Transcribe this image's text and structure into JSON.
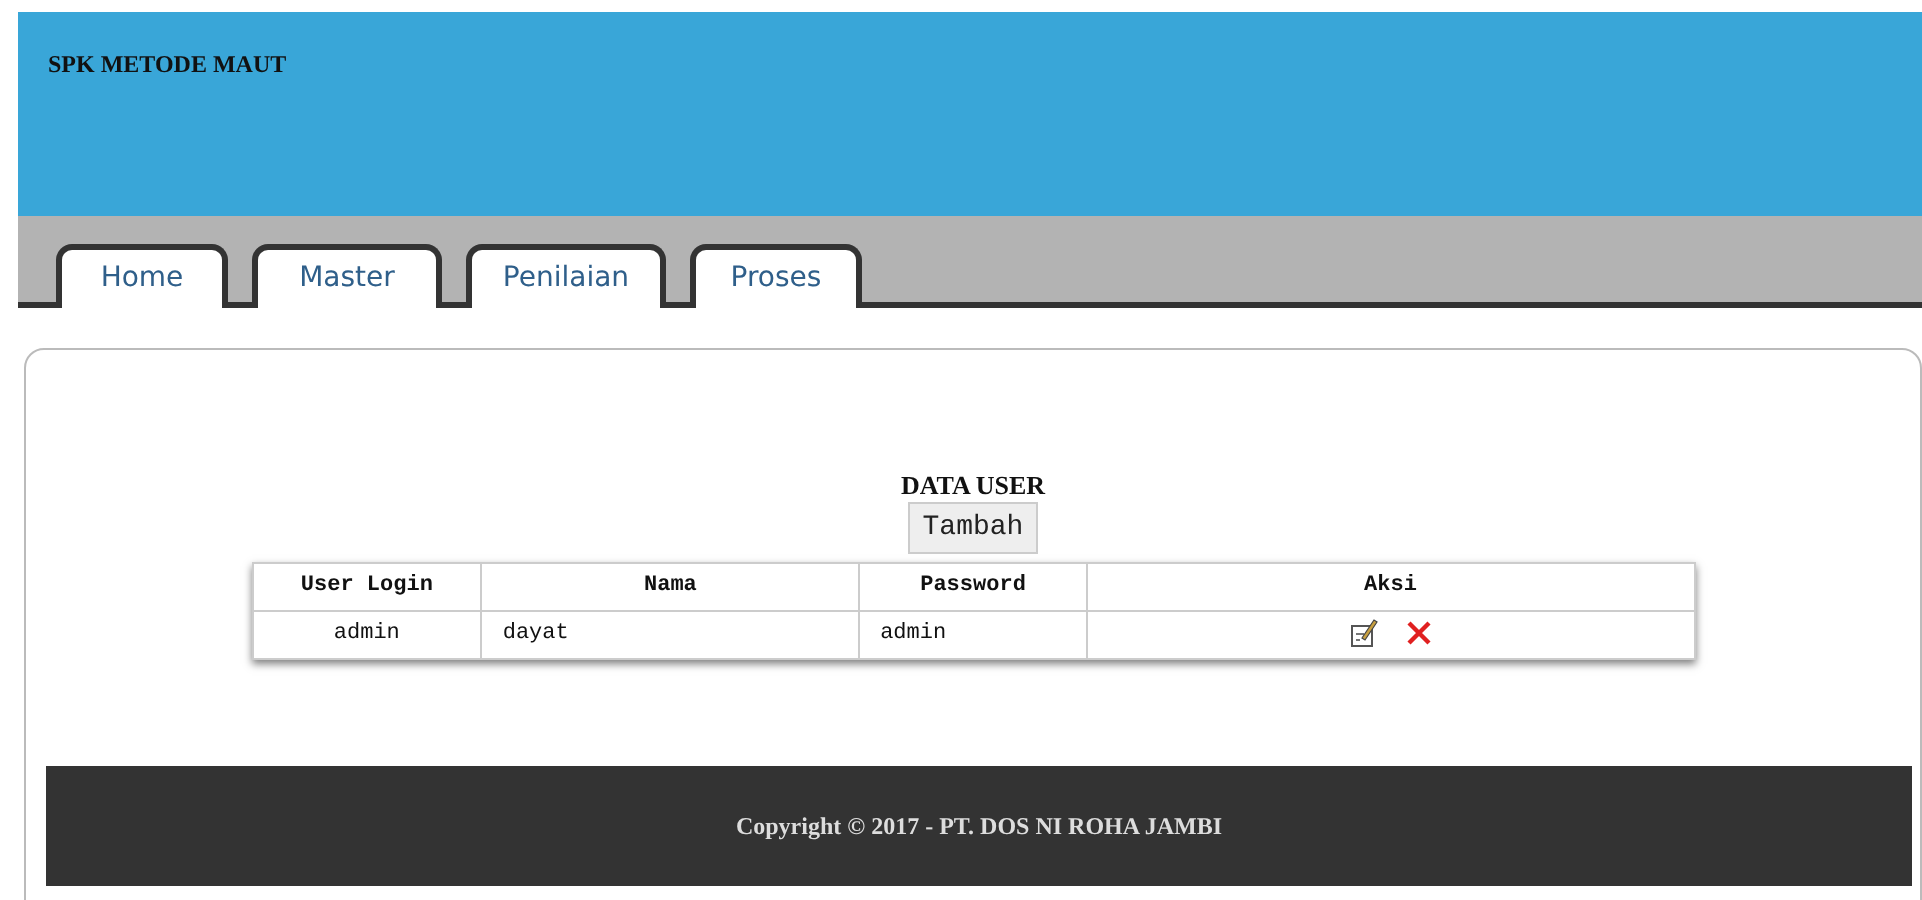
{
  "header": {
    "title": "SPK METODE MAUT"
  },
  "tabs": [
    {
      "label": "Home"
    },
    {
      "label": "Master"
    },
    {
      "label": "Penilaian"
    },
    {
      "label": "Proses"
    }
  ],
  "content": {
    "title": "DATA USER",
    "add_button": "Tambah"
  },
  "table": {
    "columns": [
      "User Login",
      "Nama",
      "Password",
      "Aksi"
    ],
    "rows": [
      {
        "user_login": "admin",
        "nama": "dayat",
        "password": "admin"
      }
    ]
  },
  "footer": "Copyright © 2017 - PT. DOS NI ROHA JAMBI"
}
